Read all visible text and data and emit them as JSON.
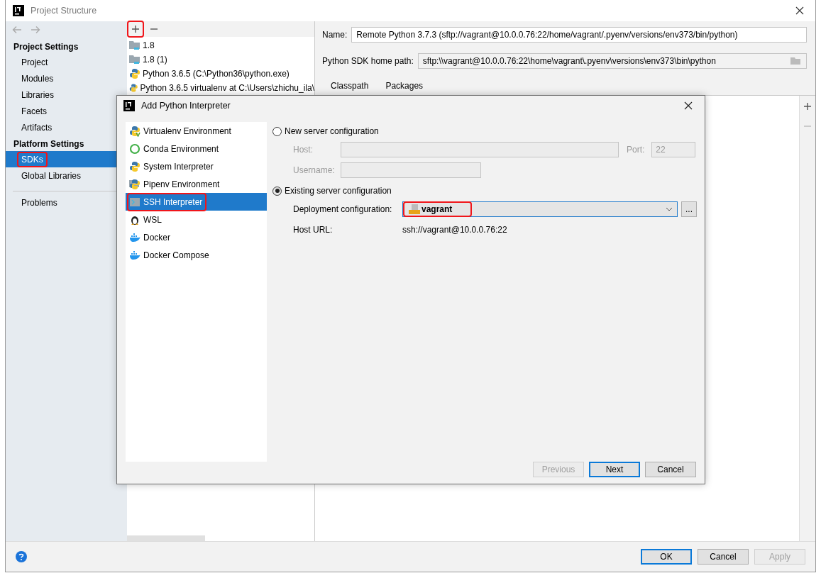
{
  "window": {
    "title": "Project Structure"
  },
  "sidebar": {
    "sections": [
      {
        "heading": "Project Settings",
        "items": [
          {
            "label": "Project",
            "selected": false,
            "highlighted": false
          },
          {
            "label": "Modules",
            "selected": false,
            "highlighted": false
          },
          {
            "label": "Libraries",
            "selected": false,
            "highlighted": false
          },
          {
            "label": "Facets",
            "selected": false,
            "highlighted": false
          },
          {
            "label": "Artifacts",
            "selected": false,
            "highlighted": false
          }
        ]
      },
      {
        "heading": "Platform Settings",
        "items": [
          {
            "label": "SDKs",
            "selected": true,
            "highlighted": true
          },
          {
            "label": "Global Libraries",
            "selected": false,
            "highlighted": false
          }
        ]
      }
    ],
    "footer_items": [
      {
        "label": "Problems",
        "selected": false,
        "highlighted": false
      }
    ]
  },
  "sdk_toolbar": {
    "add_highlighted": true
  },
  "sdk_list": [
    {
      "label": "1.8",
      "kind": "jdk"
    },
    {
      "label": "1.8 (1)",
      "kind": "jdk"
    },
    {
      "label": "Python 3.6.5 (C:\\Python36\\python.exe)",
      "kind": "python"
    },
    {
      "label": "Python 3.6.5 virtualenv at C:\\Users\\zhichu_ila\\",
      "kind": "python"
    }
  ],
  "sdk_detail": {
    "name_label": "Name:",
    "name_value": "Remote Python 3.7.3 (sftp://vagrant@10.0.0.76:22/home/vagrant/.pyenv/versions/env373/bin/python)",
    "home_label": "Python SDK home path:",
    "home_value": "sftp:\\\\vagrant@10.0.0.76:22\\home\\vagrant\\.pyenv\\versions\\env373\\bin\\python",
    "tabs": [
      {
        "label": "Classpath"
      },
      {
        "label": "Packages"
      }
    ]
  },
  "dialog": {
    "title": "Add Python Interpreter",
    "types": [
      {
        "label": "Virtualenv Environment",
        "kind": "virtualenv",
        "selected": false,
        "highlighted": false
      },
      {
        "label": "Conda Environment",
        "kind": "conda",
        "selected": false,
        "highlighted": false
      },
      {
        "label": "System Interpreter",
        "kind": "python",
        "selected": false,
        "highlighted": false
      },
      {
        "label": "Pipenv Environment",
        "kind": "pipenv",
        "selected": false,
        "highlighted": false
      },
      {
        "label": "SSH Interpreter",
        "kind": "ssh",
        "selected": true,
        "highlighted": true
      },
      {
        "label": "WSL",
        "kind": "wsl",
        "selected": false,
        "highlighted": false
      },
      {
        "label": "Docker",
        "kind": "docker",
        "selected": false,
        "highlighted": false
      },
      {
        "label": "Docker Compose",
        "kind": "docker",
        "selected": false,
        "highlighted": false
      }
    ],
    "options": [
      {
        "label": "New server configuration",
        "selected": false
      },
      {
        "label": "Existing server configuration",
        "selected": true
      }
    ],
    "host_label": "Host:",
    "port_label": "Port:",
    "port_value": "22",
    "username_label": "Username:",
    "deployment_label": "Deployment configuration:",
    "deployment_value": "vagrant",
    "deployment_highlighted": true,
    "more_button": "...",
    "host_url_label": "Host URL:",
    "host_url_value": "ssh://vagrant@10.0.0.76:22",
    "buttons": [
      {
        "label": "Previous",
        "disabled": true,
        "default": false
      },
      {
        "label": "Next",
        "disabled": false,
        "default": true
      },
      {
        "label": "Cancel",
        "disabled": false,
        "default": false
      }
    ]
  },
  "footer": {
    "buttons": [
      {
        "label": "OK",
        "disabled": false,
        "default": true
      },
      {
        "label": "Cancel",
        "disabled": false,
        "default": false
      },
      {
        "label": "Apply",
        "disabled": true,
        "default": false
      }
    ]
  }
}
